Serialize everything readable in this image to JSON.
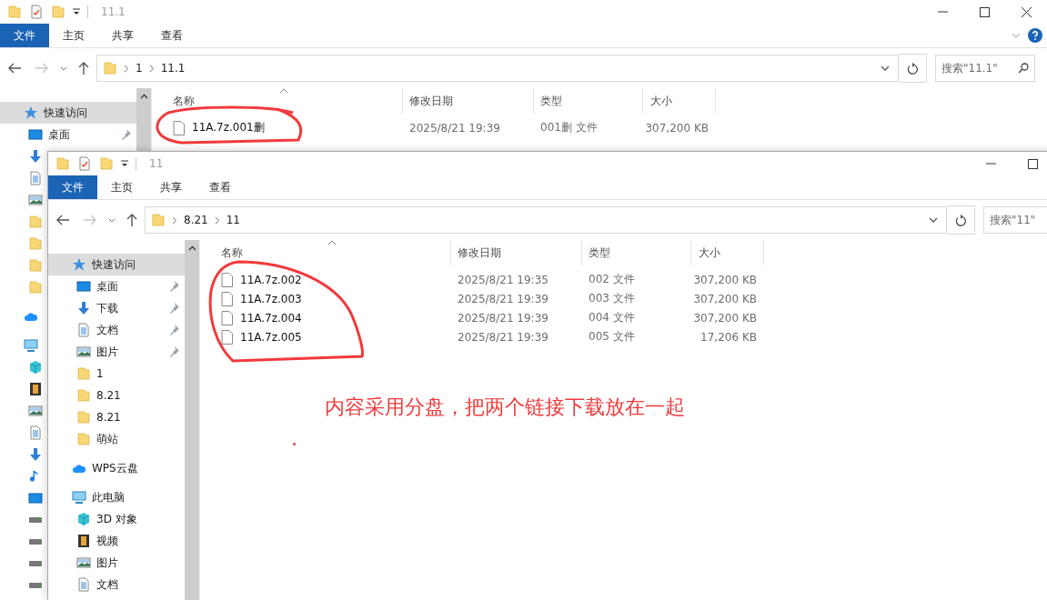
{
  "windows": [
    {
      "title": "11.1",
      "help": true,
      "controls": [
        {
          "kind": "minimize"
        },
        {
          "kind": "maximize"
        },
        {
          "kind": "close"
        }
      ],
      "ribbon_tabs": [
        {
          "label": "文件",
          "selected": true
        },
        {
          "label": "主页",
          "selected": false
        },
        {
          "label": "共享",
          "selected": false
        },
        {
          "label": "查看",
          "selected": false
        }
      ],
      "path": [
        "1",
        "11.1"
      ],
      "search": {
        "placeholder": "搜索\"11.1\"",
        "icon": true
      },
      "columns": [
        "名称",
        "修改日期",
        "类型",
        "大小"
      ],
      "files": [
        {
          "name": "11A.7z.001删",
          "modified": "2025/8/21 19:39",
          "type": "001删 文件",
          "size": "307,200 KB"
        }
      ],
      "nav": [
        {
          "kind": "star",
          "label": "快速访问",
          "selected": true,
          "pinned": false,
          "children": [
            {
              "kind": "desktop",
              "label": "桌面",
              "selected": false,
              "pinned": true
            },
            {
              "kind": "download",
              "selected": false
            },
            {
              "kind": "document",
              "selected": false
            },
            {
              "kind": "picture",
              "selected": false
            },
            {
              "kind": "folder",
              "selected": false
            },
            {
              "kind": "folder",
              "selected": false
            },
            {
              "kind": "folder",
              "selected": false
            },
            {
              "kind": "folder",
              "selected": false
            }
          ]
        },
        {
          "kind": "cloud",
          "selected": false
        },
        {
          "kind": "computer",
          "selected": false,
          "children": [
            {
              "kind": "cube",
              "selected": false
            },
            {
              "kind": "film",
              "selected": false
            },
            {
              "kind": "picture",
              "selected": false
            },
            {
              "kind": "document",
              "selected": false
            },
            {
              "kind": "download",
              "selected": false
            },
            {
              "kind": "music",
              "selected": false
            },
            {
              "kind": "desktop",
              "selected": false
            },
            {
              "kind": "drive",
              "selected": false
            },
            {
              "kind": "drive",
              "selected": false
            },
            {
              "kind": "drive",
              "selected": false
            },
            {
              "kind": "drive",
              "selected": false
            }
          ]
        }
      ]
    },
    {
      "title": "11",
      "controls": [
        {
          "kind": "minimize"
        },
        {
          "kind": "maximize"
        }
      ],
      "ribbon_tabs": [
        {
          "label": "文件",
          "selected": true
        },
        {
          "label": "主页",
          "selected": false
        },
        {
          "label": "共享",
          "selected": false
        },
        {
          "label": "查看",
          "selected": false
        }
      ],
      "path": [
        "8.21",
        "11"
      ],
      "search": {
        "placeholder": "搜索\"11\""
      },
      "columns": [
        "名称",
        "修改日期",
        "类型",
        "大小"
      ],
      "files": [
        {
          "name": "11A.7z.002",
          "modified": "2025/8/21 19:35",
          "type": "002 文件",
          "size": "307,200 KB"
        },
        {
          "name": "11A.7z.003",
          "modified": "2025/8/21 19:39",
          "type": "003 文件",
          "size": "307,200 KB"
        },
        {
          "name": "11A.7z.004",
          "modified": "2025/8/21 19:39",
          "type": "004 文件",
          "size": "307,200 KB"
        },
        {
          "name": "11A.7z.005",
          "modified": "2025/8/21 19:39",
          "type": "005 文件",
          "size": "17,206 KB"
        }
      ],
      "nav": [
        {
          "kind": "star",
          "label": "快速访问",
          "selected": true,
          "pinned": false,
          "children": [
            {
              "kind": "desktop",
              "label": "桌面",
              "selected": false,
              "pinned": true
            },
            {
              "kind": "download",
              "label": "下载",
              "selected": false,
              "pinned": true
            },
            {
              "kind": "document",
              "label": "文档",
              "selected": false,
              "pinned": true
            },
            {
              "kind": "picture",
              "label": "图片",
              "selected": false,
              "pinned": true
            },
            {
              "kind": "folder",
              "label": "1",
              "selected": false,
              "pinned": false
            },
            {
              "kind": "folder",
              "label": "8.21",
              "selected": false,
              "pinned": false
            },
            {
              "kind": "folder",
              "label": "8.21",
              "selected": false,
              "pinned": false
            },
            {
              "kind": "folder",
              "label": "萌站",
              "selected": false,
              "pinned": false
            }
          ]
        },
        {
          "kind": "cloud",
          "label": "WPS云盘",
          "selected": false,
          "pinned": false
        },
        {
          "kind": "computer",
          "label": "此电脑",
          "selected": false,
          "pinned": false,
          "children": [
            {
              "kind": "cube",
              "label": "3D 对象",
              "selected": false,
              "pinned": false
            },
            {
              "kind": "film",
              "label": "视频",
              "selected": false,
              "pinned": false
            },
            {
              "kind": "picture",
              "label": "图片",
              "selected": false,
              "pinned": false
            },
            {
              "kind": "document",
              "label": "文档",
              "selected": false,
              "pinned": false
            }
          ]
        }
      ]
    }
  ],
  "annotation": {
    "note": "内容采用分盘，把两个链接下载放在一起"
  }
}
